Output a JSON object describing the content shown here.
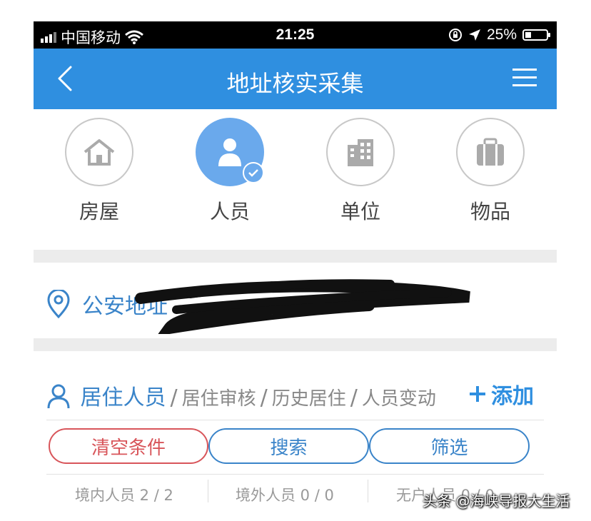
{
  "status": {
    "carrier": "中国移动",
    "time": "21:25",
    "battery": "25%"
  },
  "navbar": {
    "title": "地址核实采集"
  },
  "categories": [
    {
      "label": "房屋",
      "icon": "house-icon"
    },
    {
      "label": "人员",
      "icon": "person-icon",
      "selected": true
    },
    {
      "label": "单位",
      "icon": "building-icon"
    },
    {
      "label": "物品",
      "icon": "luggage-icon"
    }
  ],
  "address": {
    "label": "公安地址"
  },
  "resident": {
    "tabs": [
      "居住人员",
      "居住审核",
      "历史居住",
      "人员变动"
    ],
    "add_label": "添加",
    "buttons": {
      "clear": "清空条件",
      "search": "搜索",
      "filter": "筛选"
    },
    "stats": [
      "境内人员 2 / 2",
      "境外人员 0 / 0",
      "无户人员 0 / 0"
    ]
  },
  "watermark": "头条 @海峡导报大生活",
  "colors": {
    "nav": "#2f8fe0",
    "accent": "#3a84c9",
    "clear": "#d8555a"
  }
}
